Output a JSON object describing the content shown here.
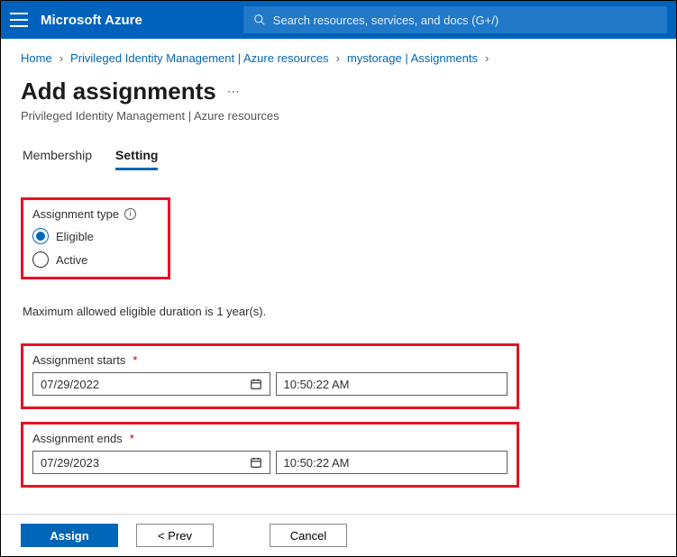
{
  "header": {
    "brand": "Microsoft Azure",
    "search_placeholder": "Search resources, services, and docs (G+/)"
  },
  "breadcrumb": {
    "items": [
      "Home",
      "Privileged Identity Management | Azure resources",
      "mystorage | Assignments"
    ]
  },
  "page": {
    "title": "Add assignments",
    "subtitle": "Privileged Identity Management | Azure resources"
  },
  "tabs": {
    "membership": "Membership",
    "setting": "Setting"
  },
  "form": {
    "assignment_type_label": "Assignment type",
    "radio_eligible": "Eligible",
    "radio_active": "Active",
    "selected_type": "Eligible",
    "duration_note": "Maximum allowed eligible duration is 1 year(s).",
    "starts_label": "Assignment starts",
    "starts_date": "07/29/2022",
    "starts_time": "10:50:22 AM",
    "ends_label": "Assignment ends",
    "ends_date": "07/29/2023",
    "ends_time": "10:50:22 AM"
  },
  "footer": {
    "assign": "Assign",
    "prev": "<  Prev",
    "cancel": "Cancel"
  }
}
